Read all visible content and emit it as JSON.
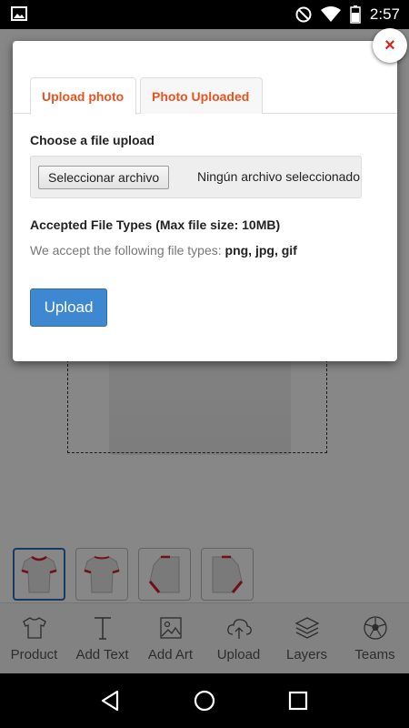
{
  "status_bar": {
    "time": "2:57",
    "icons": [
      "image-icon",
      "do-not-disturb-icon",
      "wifi-icon",
      "battery-icon"
    ]
  },
  "modal": {
    "tabs": [
      {
        "label": "Upload photo",
        "active": true
      },
      {
        "label": "Photo Uploaded",
        "active": false
      }
    ],
    "choose_label": "Choose a file upload",
    "file_button_label": "Seleccionar archivo",
    "file_status": "Ningún archivo seleccionado",
    "accepted_title": "Accepted File Types (Max file size: 10MB)",
    "accepted_prefix": "We accept the following file types: ",
    "accepted_types": "png, jpg, gif",
    "upload_button_label": "Upload",
    "close_icon": "×"
  },
  "toolbar": {
    "items": [
      {
        "label": "Product",
        "icon": "tshirt-icon"
      },
      {
        "label": "Add Text",
        "icon": "text-icon"
      },
      {
        "label": "Add Art",
        "icon": "image-icon"
      },
      {
        "label": "Upload",
        "icon": "cloud-upload-icon"
      },
      {
        "label": "Layers",
        "icon": "layers-icon"
      },
      {
        "label": "Teams",
        "icon": "soccer-ball-icon"
      }
    ]
  },
  "colors": {
    "accent_orange": "#e8541f",
    "upload_blue": "#3e87d1",
    "close_red": "#d9231d"
  }
}
